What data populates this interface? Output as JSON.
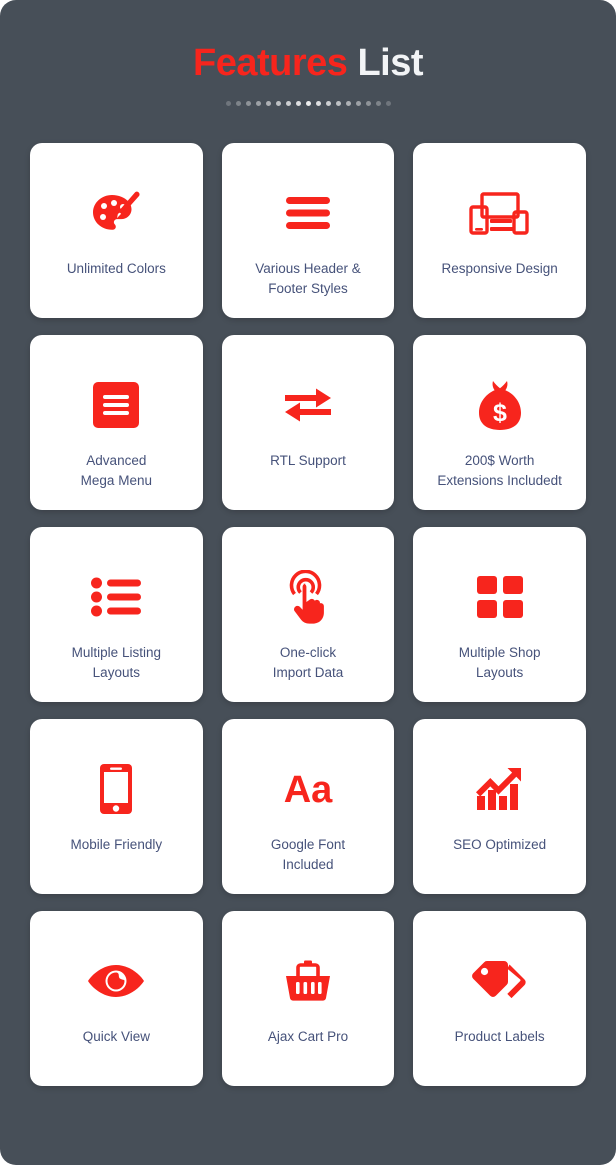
{
  "header": {
    "title_accent": "Features",
    "title_plain": "List",
    "dots_count": 17
  },
  "colors": {
    "page_background": "#474f58",
    "card_background": "#ffffff",
    "accent_red": "#f7251d",
    "label_text": "#46527a",
    "title_plain": "#f2f4f6"
  },
  "features": [
    {
      "label": "Unlimited Colors",
      "icon": "palette-icon"
    },
    {
      "label": "Various Header &\nFooter Styles",
      "icon": "hamburger-lines-icon"
    },
    {
      "label": "Responsive Design",
      "icon": "responsive-devices-icon"
    },
    {
      "label": "Advanced\nMega Menu",
      "icon": "mega-menu-icon"
    },
    {
      "label": "RTL Support",
      "icon": "exchange-arrows-icon"
    },
    {
      "label": "200$ Worth\nExtensions Includedt",
      "icon": "money-bag-icon"
    },
    {
      "label": "Multiple Listing\nLayouts",
      "icon": "bullet-list-icon"
    },
    {
      "label": "One-click\nImport Data",
      "icon": "click-hand-icon"
    },
    {
      "label": "Multiple Shop\nLayouts",
      "icon": "grid-squares-icon"
    },
    {
      "label": "Mobile Friendly",
      "icon": "mobile-phone-icon"
    },
    {
      "label": "Google Font\nIncluded",
      "icon": "aa-typography-icon"
    },
    {
      "label": "SEO Optimized",
      "icon": "growth-chart-icon"
    },
    {
      "label": "Quick View",
      "icon": "eye-icon"
    },
    {
      "label": "Ajax Cart Pro",
      "icon": "shopping-basket-icon"
    },
    {
      "label": "Product Labels",
      "icon": "price-tags-icon"
    }
  ]
}
